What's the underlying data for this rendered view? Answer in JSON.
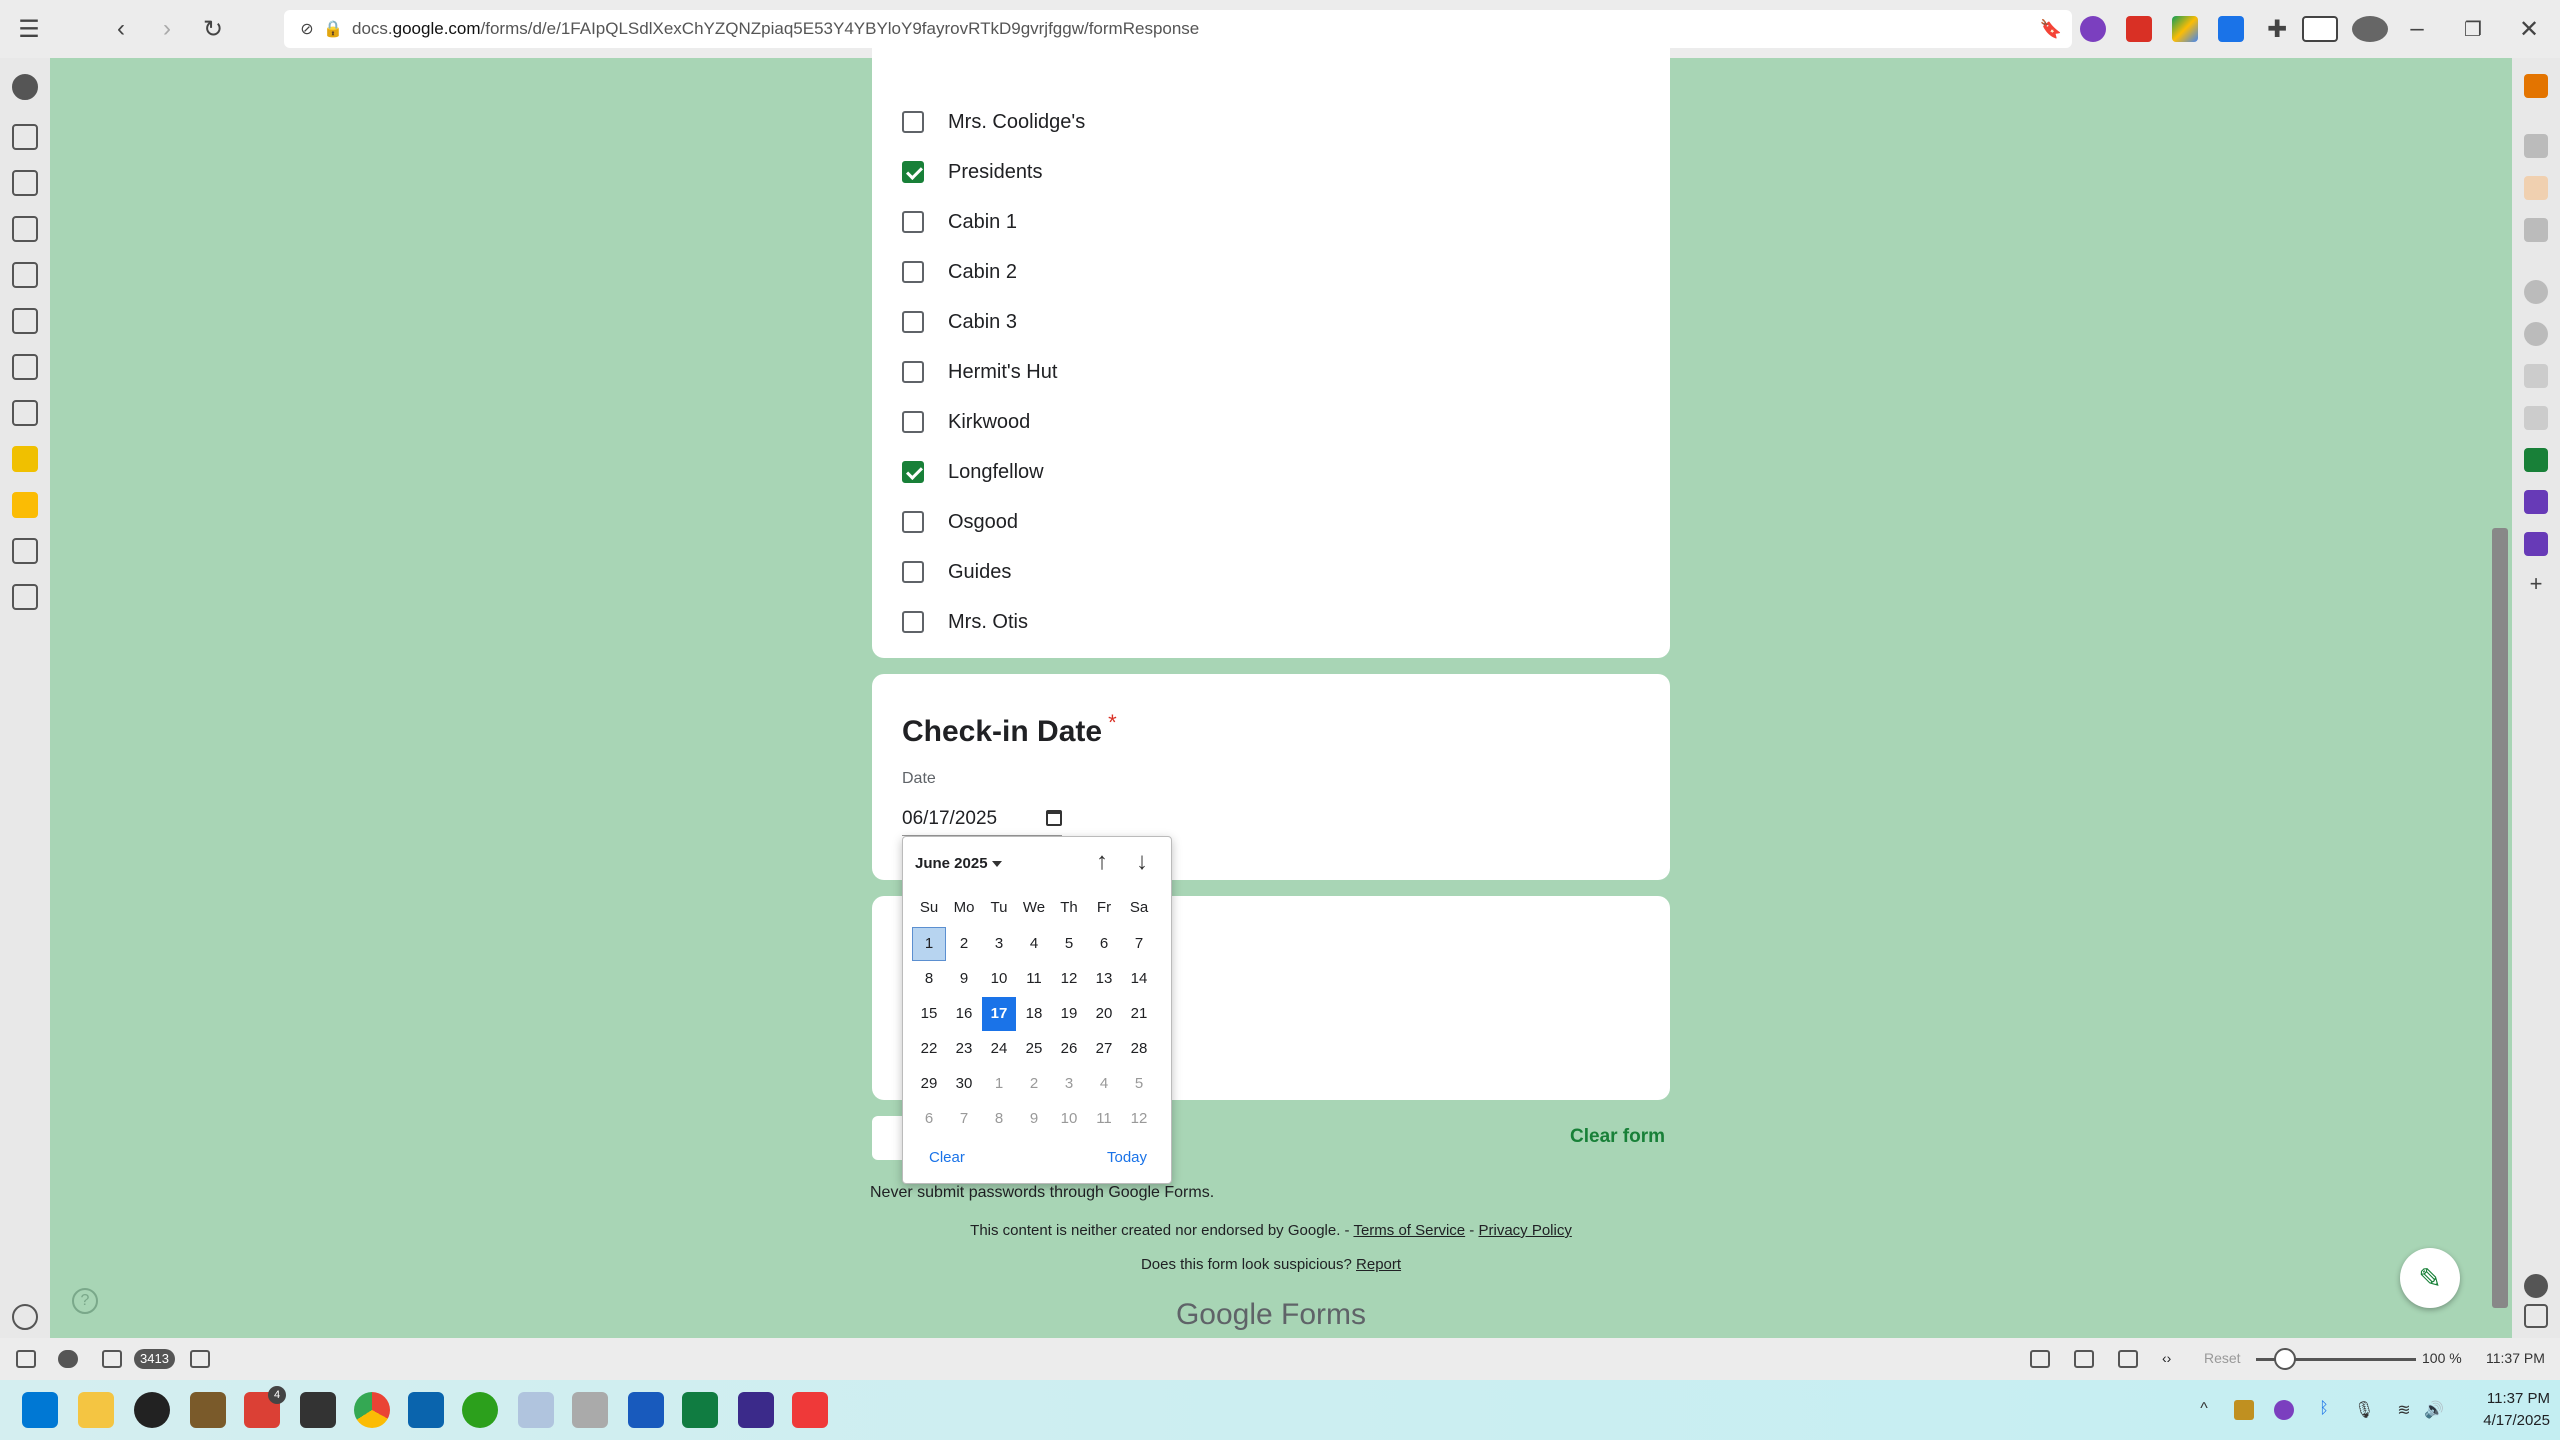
{
  "browser": {
    "url_prefix": "docs.",
    "url_domain": "google.com",
    "url_path": "/forms/d/e/1FAIpQLSdlXexChYZQNZpiaq5E53Y4YBYloY9fayrovRTkD9gvrjfggw/formResponse"
  },
  "form": {
    "options": [
      {
        "label": "Mrs. Coolidge's",
        "checked": false
      },
      {
        "label": "Presidents",
        "checked": true
      },
      {
        "label": "Cabin 1",
        "checked": false
      },
      {
        "label": "Cabin 2",
        "checked": false
      },
      {
        "label": "Cabin 3",
        "checked": false
      },
      {
        "label": "Hermit's Hut",
        "checked": false
      },
      {
        "label": "Kirkwood",
        "checked": false
      },
      {
        "label": "Longfellow",
        "checked": true
      },
      {
        "label": "Osgood",
        "checked": false
      },
      {
        "label": "Guides",
        "checked": false
      },
      {
        "label": "Mrs. Otis",
        "checked": false
      }
    ],
    "checkin": {
      "title": "Check-in Date",
      "required_mark": "*",
      "date_label": "Date",
      "date_value": "06/17/2025"
    },
    "clear_form": "Clear form",
    "never_submit": "Never submit passwords through Google Forms.",
    "disclaimer_text": "This content is neither created nor endorsed by Google. - ",
    "terms": "Terms of Service",
    "dash": " - ",
    "privacy": "Privacy Policy",
    "suspicious_text": "Does this form look suspicious? ",
    "report": "Report",
    "footer_logo": "Google Forms"
  },
  "datepicker": {
    "month_label": "June 2025",
    "weekdays": [
      "Su",
      "Mo",
      "Tu",
      "We",
      "Th",
      "Fr",
      "Sa"
    ],
    "weeks": [
      [
        "1",
        "2",
        "3",
        "4",
        "5",
        "6",
        "7"
      ],
      [
        "8",
        "9",
        "10",
        "11",
        "12",
        "13",
        "14"
      ],
      [
        "15",
        "16",
        "17",
        "18",
        "19",
        "20",
        "21"
      ],
      [
        "22",
        "23",
        "24",
        "25",
        "26",
        "27",
        "28"
      ],
      [
        "29",
        "30",
        "1",
        "2",
        "3",
        "4",
        "5"
      ],
      [
        "6",
        "7",
        "8",
        "9",
        "10",
        "11",
        "12"
      ]
    ],
    "selected_day": "17",
    "clear": "Clear",
    "today": "Today"
  },
  "statusbar": {
    "mail_count": "3413",
    "reset": "Reset",
    "zoom": "100 %",
    "time": "11:37 PM"
  },
  "taskbar": {
    "notification_count": "4",
    "time": "11:37 PM",
    "date": "4/17/2025"
  },
  "colors": {
    "page_bg": "#a8d5b5",
    "check_green": "#188038",
    "picker_blue": "#1a73e8"
  }
}
